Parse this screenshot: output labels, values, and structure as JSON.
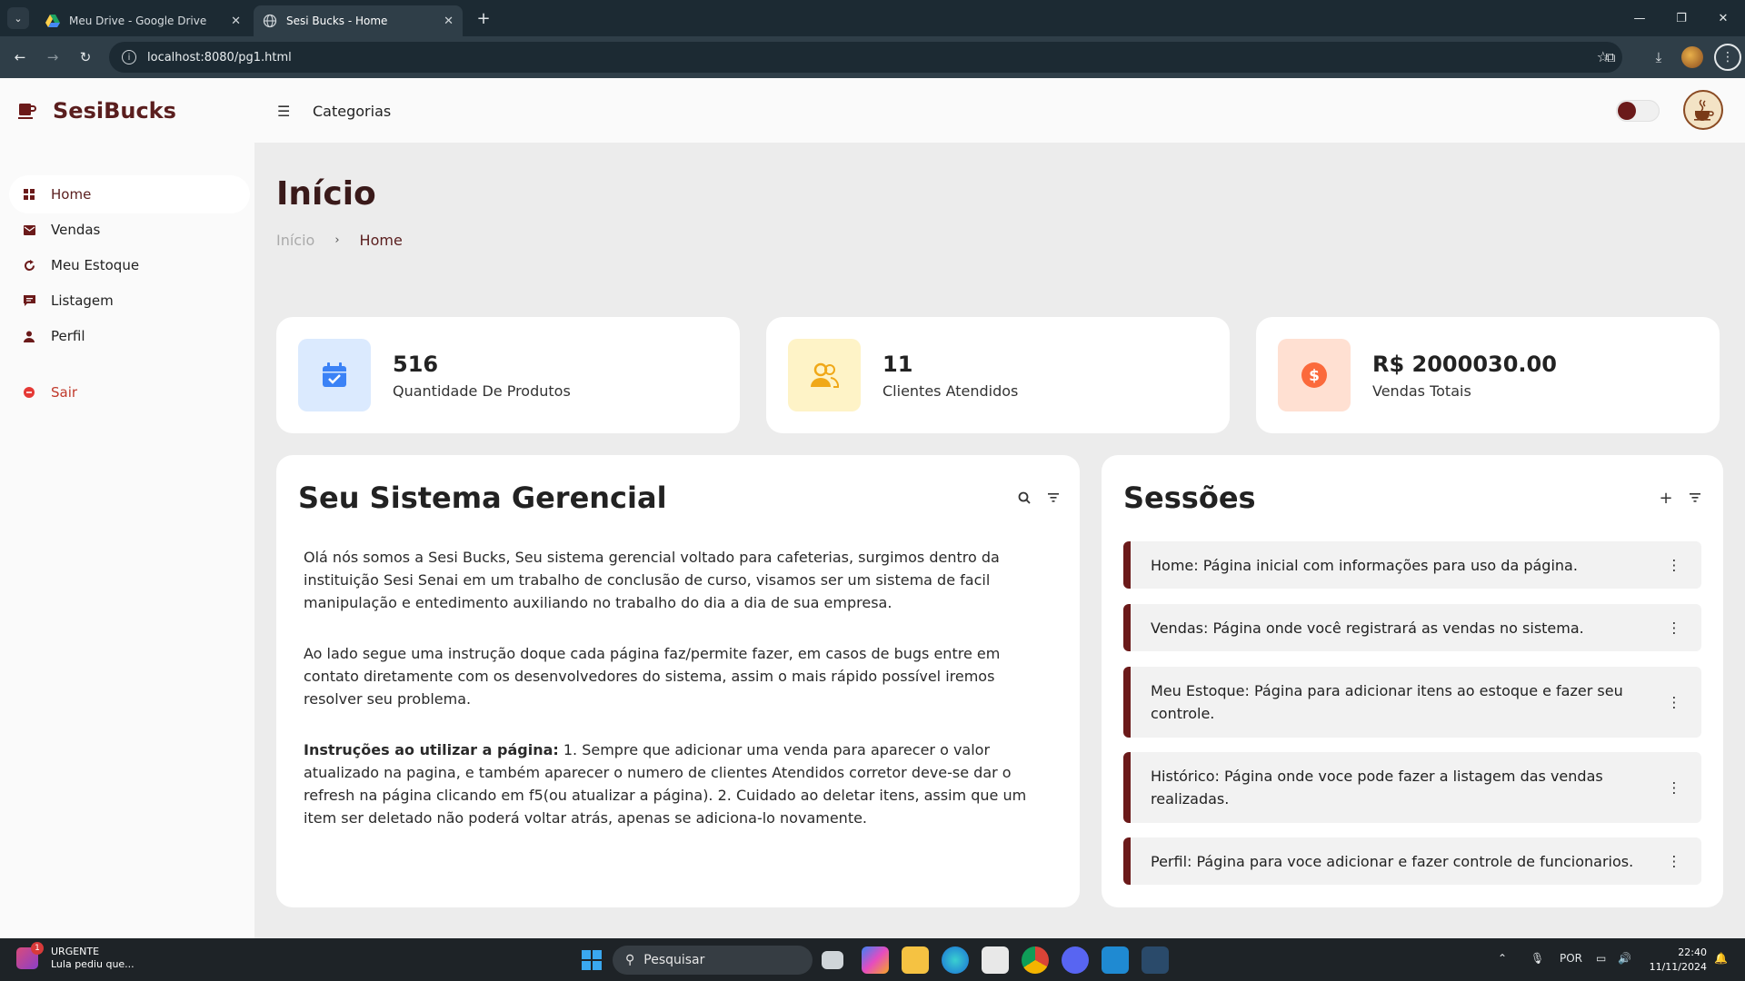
{
  "browser": {
    "tabs": [
      {
        "title": "Meu Drive - Google Drive",
        "icon": "google-drive-icon"
      },
      {
        "title": "Sesi Bucks - Home",
        "icon": "globe-icon",
        "active": true
      }
    ],
    "url": "localhost:8080/pg1.html"
  },
  "app": {
    "brand": "SesiBucks",
    "topnav_label": "Categorias",
    "theme_toggle": "dark-mode-toggle",
    "colors": {
      "primary": "#6b1a1a",
      "accent_danger": "#e53935"
    }
  },
  "sidebar": {
    "items": [
      {
        "label": "Home",
        "icon": "dashboard-icon",
        "active": true
      },
      {
        "label": "Vendas",
        "icon": "mail-icon"
      },
      {
        "label": "Meu Estoque",
        "icon": "refresh-icon"
      },
      {
        "label": "Listagem",
        "icon": "message-icon"
      },
      {
        "label": "Perfil",
        "icon": "user-icon"
      }
    ],
    "logout": {
      "label": "Sair",
      "icon": "logout-icon"
    }
  },
  "page": {
    "title": "Início",
    "breadcrumb": [
      "Início",
      "Home"
    ]
  },
  "stats": [
    {
      "value": "516",
      "label": "Quantidade De Produtos",
      "icon": "calendar-check-icon"
    },
    {
      "value": "11",
      "label": "Clientes Atendidos",
      "icon": "users-icon"
    },
    {
      "value": "R$ 2000030.00",
      "label": "Vendas Totais",
      "icon": "dollar-icon"
    }
  ],
  "system_panel": {
    "title": "Seu Sistema Gerencial",
    "paragraph1": "Olá nós somos a Sesi Bucks, Seu sistema gerencial voltado para cafeterias, surgimos dentro da instituição Sesi Senai em um trabalho de conclusão de curso, visamos ser um sistema de facil manipulação e entedimento auxiliando no trabalho do dia a dia de sua empresa.",
    "paragraph2": "Ao lado segue uma instrução doque cada página faz/permite fazer, em casos de bugs entre em contato diretamente com os desenvolvedores do sistema, assim o mais rápido possível iremos resolver seu problema.",
    "instructions_title": "Instruções ao utilizar a página:",
    "instructions_body": " 1. Sempre que adicionar uma venda para aparecer o valor atualizado na pagina, e também aparecer o numero de clientes Atendidos corretor deve-se dar o refresh na página clicando em f5(ou atualizar a página). 2. Cuidado ao deletar itens, assim que um item ser deletado não poderá voltar atrás, apenas se adiciona-lo novamente."
  },
  "sessions_panel": {
    "title": "Sessões",
    "items": [
      "Home: Página inicial com informações para uso da página.",
      "Vendas: Página onde você registrará as vendas no sistema.",
      "Meu Estoque: Página para adicionar itens ao estoque e fazer seu controle.",
      "Histórico: Página onde voce pode fazer a listagem das vendas realizadas.",
      "Perfil: Página para voce adicionar e fazer controle de funcionarios."
    ]
  },
  "taskbar": {
    "notification": {
      "title": "URGENTE",
      "body": "Lula pediu que...",
      "count": "1"
    },
    "search_placeholder": "Pesquisar",
    "lang": "POR",
    "time": "22:40",
    "date": "11/11/2024"
  }
}
